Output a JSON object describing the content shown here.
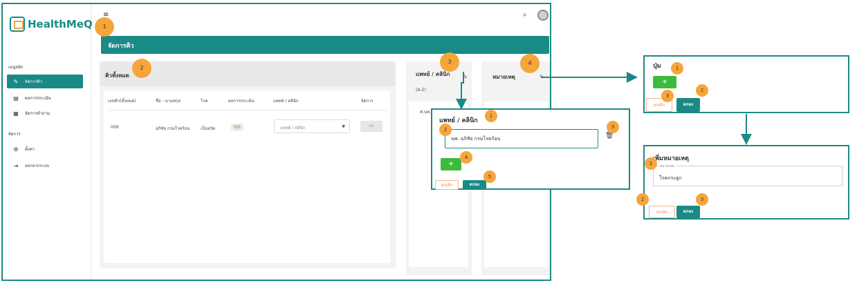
{
  "app": {
    "name": "HealthMeQ"
  },
  "sidebar": {
    "section_main": "เมนูหลัก",
    "items": [
      {
        "label": "จัดการคิว",
        "icon": "edit-icon"
      },
      {
        "label": "ผลการประเมิน",
        "icon": "clipboard-icon"
      },
      {
        "label": "จัดการคำถาม",
        "icon": "document-icon"
      }
    ],
    "section_manage": "จัดการ",
    "manage_items": [
      {
        "label": "ตั้งค่า",
        "icon": "gear-icon"
      },
      {
        "label": "ออกจากระบบ",
        "icon": "logout-icon"
      }
    ]
  },
  "topbar": {
    "menu_icon": "≡",
    "search_icon": "🔍"
  },
  "page": {
    "title": "จัดการคิว"
  },
  "queue_panel": {
    "title": "คิวทั้งหมด",
    "columns": [
      "เลขคิว(ทั้งหมด)",
      "ชื่อ - นามสกุล",
      "โรค",
      "ผลการประเมิน",
      "แพทย์ / คลินิก",
      "จัดการ"
    ],
    "rows": [
      {
        "queue_no": "009",
        "name": "อภิชัย กรมโรคร้อน",
        "disease": "เป็นหวัด",
        "result": "0/0",
        "doctor_placeholder": "แพทย์ / คลินิก",
        "action": "ลบ"
      }
    ]
  },
  "doctor_column": {
    "title": "แพทย์ / คลินิก",
    "subtitle": "(A-Z)",
    "entry": "A:นพ.อภิชัย กรมโรคร้อน"
  },
  "note_column": {
    "title": "หมายเหตุ"
  },
  "doctor_popup": {
    "title": "แพทย์ / คลินิก",
    "field_value": "นพ. อภิชัย กรมโรคร้อน",
    "add_label": "+",
    "cancel_label": "ยกเลิก",
    "ok_label": "ตกลง"
  },
  "button_popup": {
    "title": "ปุ่ม",
    "add_label": "+",
    "cancel_label": "ยกเลิก",
    "ok_label": "ตกลง"
  },
  "note_popup": {
    "title": "เพิ่มหมายเหตุ",
    "field_label": "หมายเหตุ",
    "field_value": "โรคกระดูก",
    "cancel_label": "ยกเลิก",
    "ok_label": "ตกลง"
  },
  "callouts": {
    "main_1": "1",
    "main_2": "2",
    "main_3": "3",
    "main_4": "4",
    "doc_1": "1",
    "doc_2": "2",
    "doc_3": "3",
    "doc_4": "4",
    "doc_5": "5",
    "btn_1": "1",
    "btn_2": "2",
    "btn_3": "3",
    "note_1": "1",
    "note_2": "2",
    "note_3": "3"
  },
  "colors": {
    "accent": "#1a8a86",
    "callout": "#f6a53a",
    "add": "#3dbb3d",
    "cancel": "#f08a3c"
  }
}
